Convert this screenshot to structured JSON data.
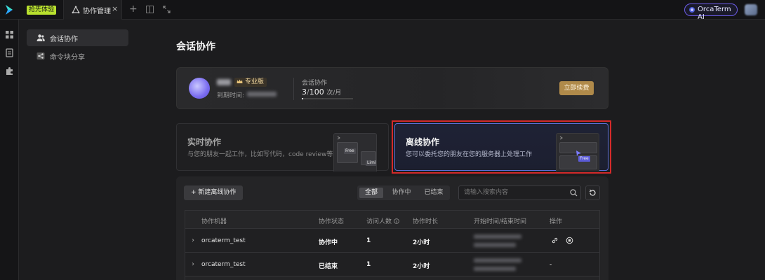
{
  "topbar": {
    "promo_label": "抢先体验",
    "tab_title": "协作管理",
    "tab_close": "×",
    "new_tab": "+",
    "orca_label": "OrcaTerm AI"
  },
  "sidebar": {
    "items": [
      {
        "label": "会话协作",
        "icon": "people-icon",
        "active": true
      },
      {
        "label": "命令块分享",
        "icon": "share-icon",
        "active": false
      }
    ]
  },
  "page": {
    "title": "会话协作"
  },
  "plan": {
    "badge": "专业版",
    "expire_label": "到期时间:",
    "quota_label": "会话协作",
    "quota_used": "3",
    "quota_sep": "/",
    "quota_total": "100",
    "quota_unit": "次/月",
    "quota_fraction": 0.03,
    "renew_label": "立即续费"
  },
  "modes": {
    "realtime": {
      "title": "实时协作",
      "desc": "与您的朋友一起工作，比如写代码，code review等",
      "tags": [
        "Free",
        "Limits"
      ]
    },
    "offline": {
      "title": "离线协作",
      "desc": "您可以委托您的朋友在您的服务器上处理工作",
      "tags": [
        "Free"
      ]
    }
  },
  "toolbar": {
    "new_label": "+ 新建离线协作",
    "filters": [
      "全部",
      "协作中",
      "已结束"
    ],
    "active_filter": 0,
    "search_placeholder": "请输入搜索内容"
  },
  "table": {
    "columns": [
      "协作机器",
      "协作状态",
      "访问人数",
      "协作时长",
      "开始时间/结束时间",
      "操作"
    ],
    "rows": [
      {
        "machine": "orcaterm_test",
        "status": "协作中",
        "visitors": "1",
        "duration": "2小时",
        "actions": [
          "link-icon",
          "stop-icon"
        ]
      },
      {
        "machine": "orcaterm_test",
        "status": "已结束",
        "visitors": "1",
        "duration": "2小时",
        "action_text": "-"
      }
    ]
  },
  "colors": {
    "accent": "#5b6fd8",
    "renew": "#b08a4a",
    "promo": "#b8e02e",
    "selection": "#d42a2a"
  }
}
